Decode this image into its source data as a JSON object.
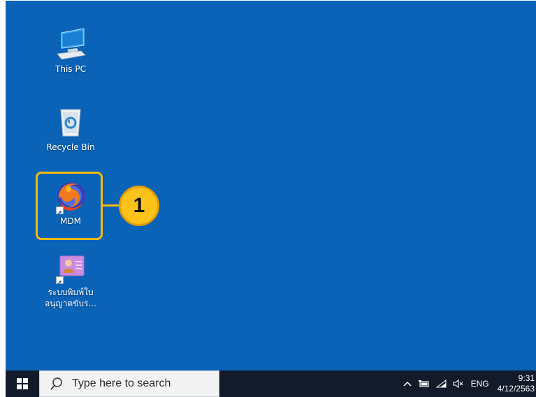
{
  "desktop": {
    "background": "#0b63b7",
    "icons": [
      {
        "label": "This PC",
        "icon": "computer-monitor-icon"
      },
      {
        "label": "Recycle Bin",
        "icon": "recycle-bin-icon"
      },
      {
        "label": "MDM",
        "icon": "firefox-icon",
        "shortcut": true
      },
      {
        "label_line1": "ระบบพิมพ์ใบ",
        "label_line2": "อนุญาตขับร...",
        "icon": "id-card-icon",
        "shortcut": true
      }
    ]
  },
  "callout": {
    "number": "1",
    "color": "#fbc21a"
  },
  "taskbar": {
    "start_icon": "windows-start-icon",
    "search_placeholder": "Type here to search",
    "tray": {
      "chevron": "^",
      "language": "ENG",
      "time": "9:31",
      "date": "4/12/2563"
    }
  }
}
